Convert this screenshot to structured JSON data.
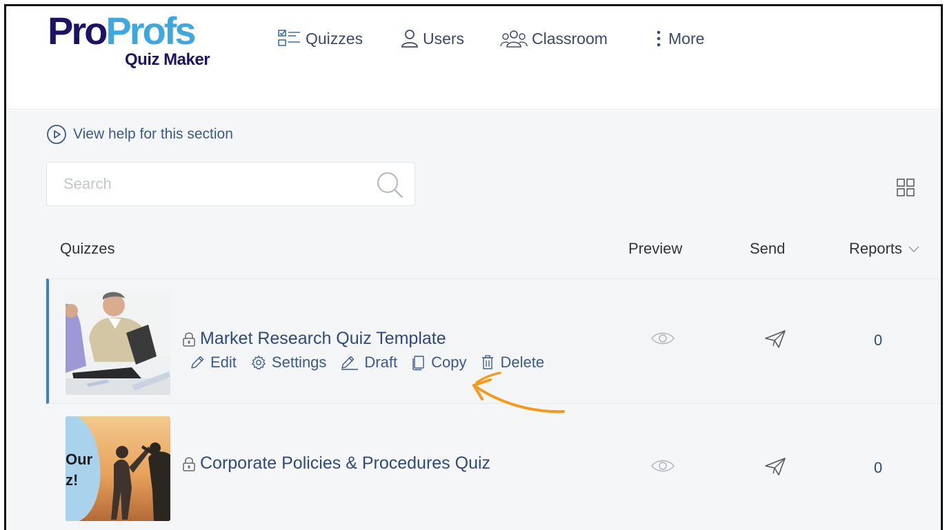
{
  "header": {
    "logo_pro": "Pro",
    "logo_profs": "Profs",
    "logo_sub": "Quiz Maker",
    "nav": [
      {
        "label": "Quizzes",
        "icon": "quiz-list-icon"
      },
      {
        "label": "Users",
        "icon": "user-icon"
      },
      {
        "label": "Classroom",
        "icon": "group-icon"
      },
      {
        "label": "More",
        "icon": "vertical-dots-icon"
      }
    ]
  },
  "help": {
    "label": "View help for this section",
    "icon": "play-circle-icon"
  },
  "search": {
    "placeholder": "Search",
    "value": "",
    "icon": "search-icon"
  },
  "view_toggle": {
    "icon": "grid-view-icon"
  },
  "table": {
    "columns": [
      "Quizzes",
      "Preview",
      "Send",
      "Reports"
    ],
    "sort_icon": "chevron-down-icon",
    "rows": [
      {
        "title": "Market Research Quiz Template",
        "lock_icon": "lock-icon",
        "actions": [
          "Edit",
          "Settings",
          "Draft",
          "Copy",
          "Delete"
        ],
        "reports": "0"
      },
      {
        "title": "Corporate Policies & Procedures Quiz",
        "lock_icon": "lock-icon",
        "thumb_text": [
          "Our",
          "z!"
        ],
        "reports": "0"
      }
    ]
  },
  "colors": {
    "brand_dark": "#1b1464",
    "brand_light": "#3ea7e0",
    "link": "#2f4a7d",
    "selected_row_accent": "#3b7dd8",
    "annotation_arrow": "#f39a1e"
  }
}
